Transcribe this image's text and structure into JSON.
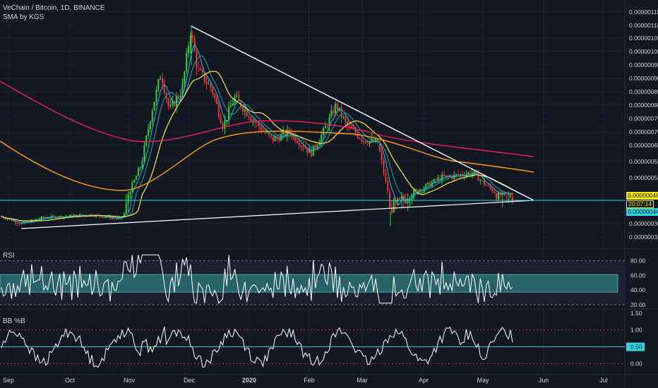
{
  "header": {
    "title": "VeChain / Bitcoin, 1D, BINANCE",
    "indicator": "SMA by KGS"
  },
  "panes": {
    "rsi_label": "RSI",
    "bb_label": "BB %B"
  },
  "colors": {
    "background": "#131722",
    "grid": "#1e222d",
    "up": "#26d73a",
    "down": "#e8382f",
    "trendline": "#ffffff",
    "support": "#31d4dd",
    "sma_fast": "#29b6f6",
    "sma_teal": "#26a69a",
    "sma_yellow": "#f7e84a",
    "sma_orange": "#ff9e1b",
    "sma_slow": "#e91e63",
    "rsi_band": "#2b7a7c",
    "price_tag": "#f4e900",
    "countdown_tag": "#f4e900",
    "support_tag": "#31d4dd"
  },
  "price_tags": {
    "last_price": "0.00000046",
    "countdown": "20:07:14",
    "support_price": "0.00000044"
  },
  "chart_data": [
    {
      "type": "candlestick",
      "title": "VeChain / Bitcoin, 1D, BINANCE",
      "x_tick_labels": [
        "Sep",
        "Oct",
        "Nov",
        "Dec",
        "2020",
        "Feb",
        "Mar",
        "Apr",
        "May",
        "Jun",
        "Jul"
      ],
      "y_tick_labels": [
        "0.00000115",
        "0.00000110",
        "0.00000105",
        "0.00000100",
        "0.00000095",
        "0.00000090",
        "0.00000085",
        "0.00000080",
        "0.00000075",
        "0.00000070",
        "0.00000065",
        "0.00000059",
        "0.00000053",
        "0.00000046",
        "0.00000044",
        "0.00000036",
        "0.00000031"
      ],
      "ylim": [
        2.8e-07,
        1.18e-06
      ],
      "key_points": {
        "swing_high": {
          "date": "Dec",
          "value": 1.1e-06
        },
        "low": {
          "date": "Sep",
          "value": 3.3e-07
        },
        "last_close": 4.6e-07,
        "support": 4.4e-07
      },
      "trendlines": [
        {
          "name": "descending resistance",
          "from": [
            1.1e-06
          ],
          "to": [
            4.6e-07
          ]
        },
        {
          "name": "ascending support",
          "from": [
            3.3e-07
          ],
          "to": [
            4.6e-07
          ]
        }
      ]
    },
    {
      "type": "line",
      "title": "RSI",
      "y_tick_labels": [
        "80.00",
        "60.00",
        "40.00",
        "20.00"
      ],
      "ylim": [
        15,
        95
      ],
      "band": [
        37,
        61
      ],
      "dashed_levels": [
        80,
        20
      ]
    },
    {
      "type": "line",
      "title": "BB %B",
      "y_tick_labels": [
        "1.50",
        "1.00",
        "0.50",
        "0.00"
      ],
      "ylim": [
        -0.3,
        1.6
      ],
      "levels": [
        1.0,
        0.5,
        0.0
      ],
      "highlight_level": "0.50"
    }
  ]
}
